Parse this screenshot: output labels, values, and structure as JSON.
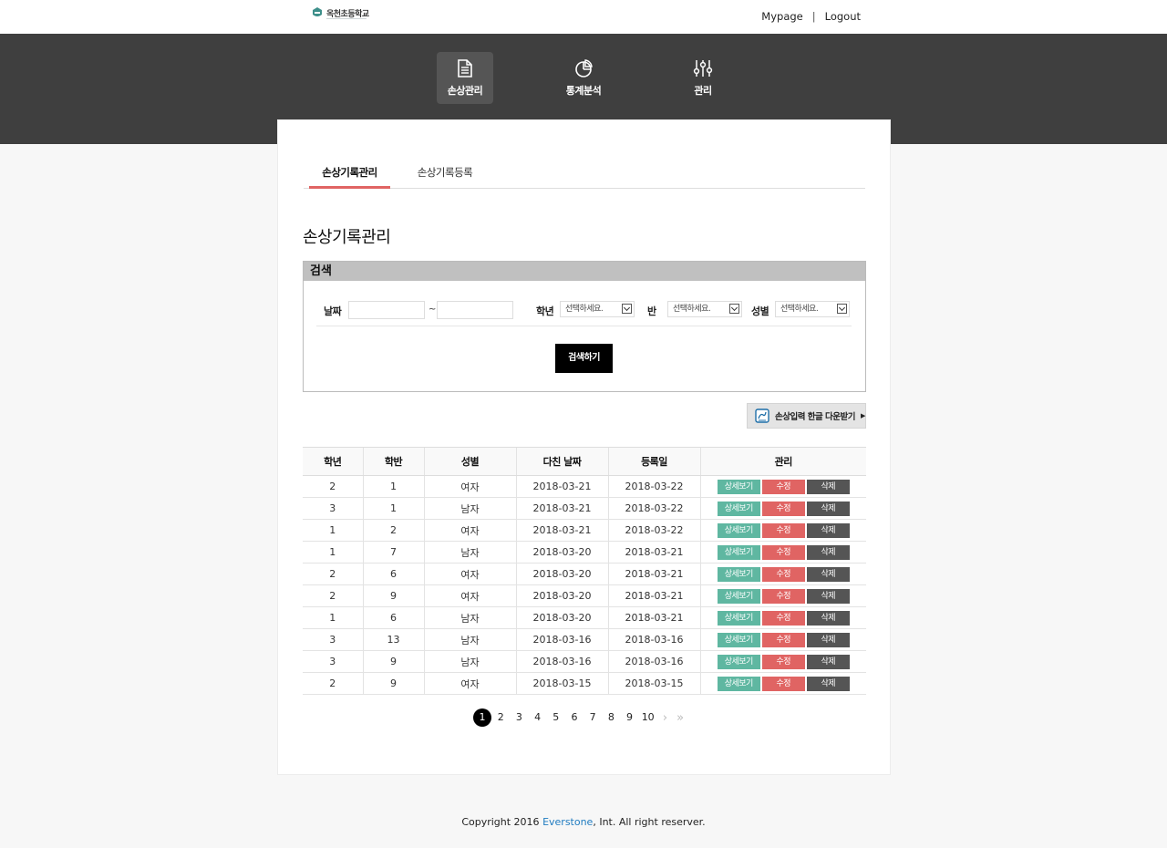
{
  "header": {
    "logo_text": "옥천초등학교",
    "links": {
      "mypage": "Mypage",
      "separator": "|",
      "logout": "Logout"
    }
  },
  "nav": [
    {
      "label": "손상관리",
      "icon": "document-icon",
      "active": true
    },
    {
      "label": "통계분석",
      "icon": "pie-chart-icon",
      "active": false
    },
    {
      "label": "관리",
      "icon": "sliders-icon",
      "active": false
    }
  ],
  "tabs": [
    {
      "label": "손상기록관리",
      "active": true
    },
    {
      "label": "손상기록등록",
      "active": false
    }
  ],
  "page_title": "손상기록관리",
  "search": {
    "header": "검색",
    "date_label": "날짜",
    "date_from": "",
    "date_to": "",
    "tilde": "~",
    "grade_label": "학년",
    "grade_value": "선택하세요.",
    "class_label": "반",
    "class_value": "선택하세요.",
    "gender_label": "성별",
    "gender_value": "선택하세요.",
    "button": "검색하기"
  },
  "download_button": "손상입력 한글 다운받기",
  "table": {
    "headers": [
      "학년",
      "학반",
      "성별",
      "다친 날짜",
      "등록일",
      "관리"
    ],
    "rows": [
      [
        "2",
        "1",
        "여자",
        "2018-03-21",
        "2018-03-22"
      ],
      [
        "3",
        "1",
        "남자",
        "2018-03-21",
        "2018-03-22"
      ],
      [
        "1",
        "2",
        "여자",
        "2018-03-21",
        "2018-03-22"
      ],
      [
        "1",
        "7",
        "남자",
        "2018-03-20",
        "2018-03-21"
      ],
      [
        "2",
        "6",
        "여자",
        "2018-03-20",
        "2018-03-21"
      ],
      [
        "2",
        "9",
        "여자",
        "2018-03-20",
        "2018-03-21"
      ],
      [
        "1",
        "6",
        "남자",
        "2018-03-20",
        "2018-03-21"
      ],
      [
        "3",
        "13",
        "남자",
        "2018-03-16",
        "2018-03-16"
      ],
      [
        "3",
        "9",
        "남자",
        "2018-03-16",
        "2018-03-16"
      ],
      [
        "2",
        "9",
        "여자",
        "2018-03-15",
        "2018-03-15"
      ]
    ],
    "action_labels": {
      "view": "상세보기",
      "edit": "수정",
      "delete": "삭제"
    }
  },
  "pagination": {
    "pages": [
      "1",
      "2",
      "3",
      "4",
      "5",
      "6",
      "7",
      "8",
      "9",
      "10"
    ],
    "current": "1",
    "next": "›",
    "last": "»"
  },
  "footer": {
    "prefix": "Copyright 2016 ",
    "brand": "Everstone",
    "suffix": ", Int. All right reserver."
  },
  "colors": {
    "nav_bg": "#3f3f3f",
    "tab_underline": "#e06463",
    "view": "#5fb7a1",
    "edit": "#e06463",
    "delete": "#555555",
    "brand_link": "#1f7bc0"
  }
}
